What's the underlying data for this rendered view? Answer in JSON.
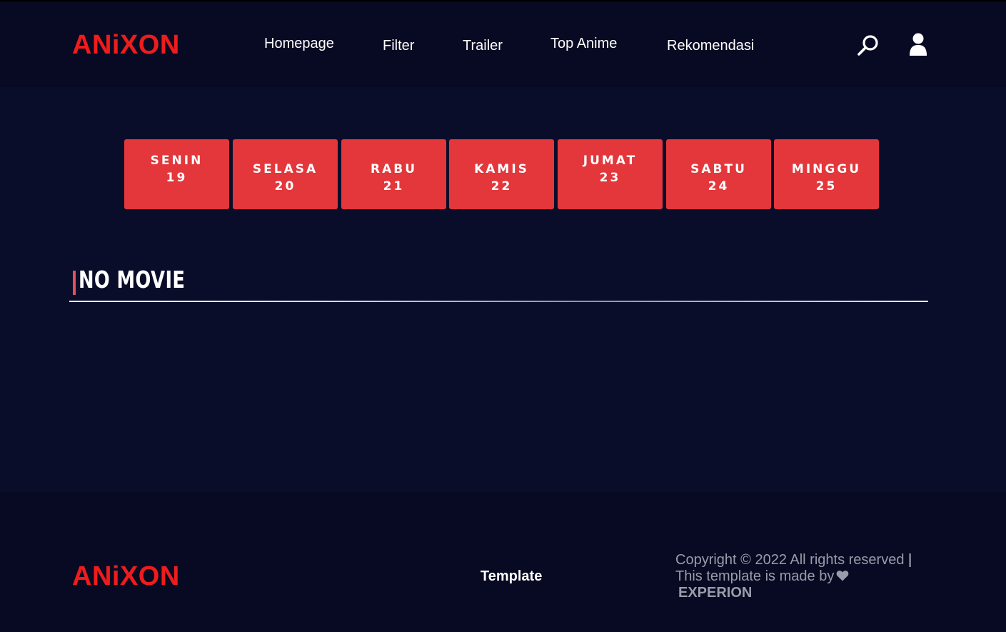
{
  "header": {
    "logo": "ANiXON",
    "nav": [
      {
        "label": "Homepage"
      },
      {
        "label": "Filter"
      },
      {
        "label": "Trailer"
      },
      {
        "label": "Top Anime"
      },
      {
        "label": "Rekomendasi"
      }
    ],
    "icons": {
      "search": "search-icon",
      "user": "user-icon"
    }
  },
  "schedule": {
    "days": [
      {
        "name": "SENIN",
        "date": "19"
      },
      {
        "name": "SELASA",
        "date": "20"
      },
      {
        "name": "RABU",
        "date": "21"
      },
      {
        "name": "KAMIS",
        "date": "22"
      },
      {
        "name": "JUMAT",
        "date": "23"
      },
      {
        "name": "SABTU",
        "date": "24"
      },
      {
        "name": "MINGGU",
        "date": "25"
      }
    ]
  },
  "section": {
    "title": "NO MOVIE"
  },
  "footer": {
    "logo": "ANiXON",
    "link": "Template",
    "copyright_line1": "Copyright © 2022 All rights reserved",
    "separator": "|",
    "copyright_line2": "This template is made by",
    "credit": "EXPERION"
  },
  "colors": {
    "background": "#0a0d2a",
    "header_background": "#070a22",
    "brand": "#ee1c1c",
    "accent": "#e3373b",
    "text": "#ffffff",
    "muted_text": "#9a9cab"
  }
}
